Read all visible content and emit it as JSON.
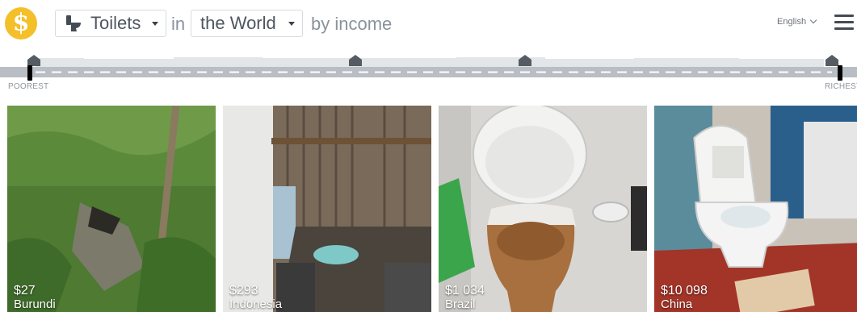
{
  "header": {
    "logo_glyph": "$",
    "thing_select": {
      "selected": "Toilets",
      "icon": "toilet-icon"
    },
    "word_in": "in",
    "place_select": {
      "selected": "the World"
    },
    "word_income": "by income",
    "language": "English",
    "menu_icon": "hamburger-icon"
  },
  "street": {
    "poorest_label": "POOREST",
    "richest_label": "RICHEST"
  },
  "cards": [
    {
      "income": "$27",
      "country": "Burundi"
    },
    {
      "income": "$293",
      "country": "Indonesia"
    },
    {
      "income": "$1 034",
      "country": "Brazil"
    },
    {
      "income": "$10 098",
      "country": "China"
    }
  ],
  "colors": {
    "logo": "#f4bf28",
    "street_road": "#b9bec4",
    "street_house": "#555c63",
    "text": "#5d6570"
  }
}
